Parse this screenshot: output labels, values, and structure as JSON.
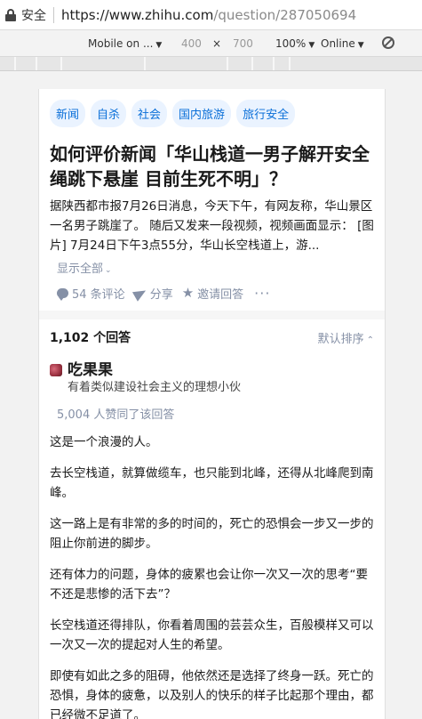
{
  "browser": {
    "secure_label": "安全",
    "url_host": "https://www.zhihu.com",
    "url_path": "/question/287050694"
  },
  "devtools": {
    "device": "Mobile on ...",
    "width": "400",
    "times": "×",
    "height": "700",
    "zoom": "100%",
    "network": "Online"
  },
  "question": {
    "tags": [
      "新闻",
      "自杀",
      "社会",
      "国内旅游",
      "旅行安全"
    ],
    "title": "如何评价新闻「华山栈道一男子解开安全绳跳下悬崖 目前生死不明」？",
    "description": "据陕西都市报7月26日消息，今天下午，有网友称，华山景区一名男子跳崖了。 随后又发来一段视频，视频画面显示： [图片] 7月24日下午3点55分，华山长空栈道上，游...",
    "show_all": "显示全部",
    "comments": "54 条评论",
    "share": "分享",
    "invite": "邀请回答",
    "more": "···"
  },
  "answers": {
    "count": "1,102 个回答",
    "sort": "默认排序"
  },
  "answer": {
    "author_name": "吃果果",
    "author_bio": "有着类似建设社会主义的理想小伙",
    "likes": "5,004 人赞同了该回答",
    "paragraphs": [
      "这是一个浪漫的人。",
      "去长空栈道，就算做缆车，也只能到北峰，还得从北峰爬到南峰。",
      "这一路上是有非常的多的时间的，死亡的恐惧会一步又一步的阻止你前进的脚步。",
      "还有体力的问题，身体的疲累也会让你一次又一次的思考“要不还是悲惨的活下去”？",
      "长空栈道还得排队，你看着周围的芸芸众生，百般模样又可以一次又一次的提起对人生的希望。",
      "即使有如此之多的阻碍，他依然还是选择了终身一跃。死亡的恐惧，身体的疲惫，以及别人的快乐的样子比起那个理由，都已经微不足道了。"
    ]
  }
}
